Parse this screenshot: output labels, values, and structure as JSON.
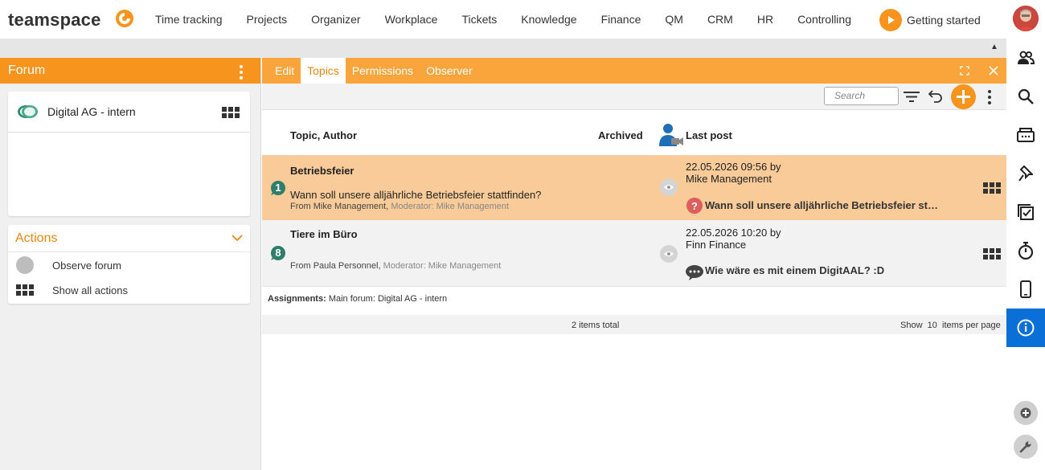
{
  "app": {
    "logo_text": "teamspace",
    "nav": [
      "Time tracking",
      "Projects",
      "Organizer",
      "Workplace",
      "Tickets",
      "Knowledge",
      "Finance",
      "QM",
      "CRM",
      "HR",
      "Controlling"
    ],
    "getting_started": "Getting started",
    "brand_color": "#f7941d"
  },
  "left_panel": {
    "title": "Forum",
    "forum_name": "Digital AG - intern",
    "actions_title": "Actions",
    "actions": [
      {
        "label": "Observe forum",
        "icon": "gray-circle-icon"
      },
      {
        "label": "Show all actions",
        "icon": "grid-icon"
      }
    ]
  },
  "main": {
    "tabs": [
      "Edit",
      "Topics",
      "Permissions",
      "Observer"
    ],
    "active_tab": "Topics",
    "search_placeholder": "Search",
    "columns": {
      "topic": "Topic, Author",
      "archived": "Archived",
      "last_post": "Last post"
    },
    "rows": [
      {
        "count": "1",
        "title": "Betriebsfeier",
        "question": "Wann soll unsere alljährliche Betriebsfeier stattfinden?",
        "from": "From Mike Management,",
        "moderator": "Moderator: Mike Management",
        "last_post_date": "22.05.2026 09:56 by",
        "last_post_author": "Mike Management",
        "last_post_title": "Wann soll unsere alljährliche Betriebsfeier st…",
        "last_post_icon": "question-icon"
      },
      {
        "count": "8",
        "title": "Tiere im Büro",
        "question": "",
        "from": "From Paula Personnel,",
        "moderator": "Moderator: Mike Management",
        "last_post_date": "22.05.2026 10:20 by",
        "last_post_author": "Finn Finance",
        "last_post_title": "Wie wäre es mit einem DigitAAL? :D",
        "last_post_icon": "chat-bubble-icon"
      }
    ],
    "assignments_label": "Assignments:",
    "assignments_value": "Main forum: Digital AG - intern",
    "total": "2 items total",
    "show_label": "Show",
    "per_page": "10",
    "per_page_suffix": "items per page"
  }
}
